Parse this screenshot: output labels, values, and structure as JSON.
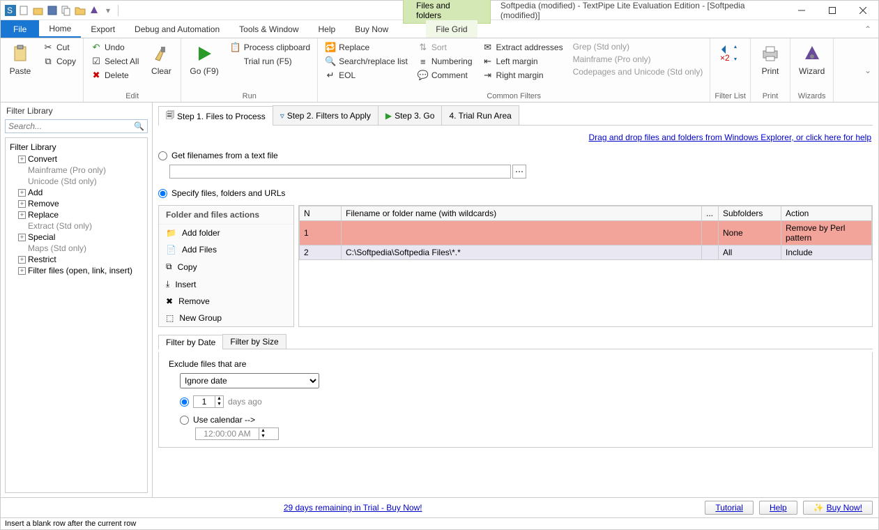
{
  "titlebar": {
    "context_tab": "Files and folders",
    "title": "Softpedia (modified) - TextPipe Lite Evaluation Edition - [Softpedia (modified)]"
  },
  "menu": {
    "file": "File",
    "home": "Home",
    "export": "Export",
    "debug": "Debug and Automation",
    "tools": "Tools & Window",
    "help": "Help",
    "buy": "Buy Now",
    "filegrid": "File Grid"
  },
  "ribbon": {
    "paste": "Paste",
    "cut": "Cut",
    "copy": "Copy",
    "edit_group": "Edit",
    "undo": "Undo",
    "select_all": "Select All",
    "delete": "Delete",
    "clear": "Clear",
    "go": "Go (F9)",
    "process_clipboard": "Process clipboard",
    "trial_run": "Trial run (F5)",
    "run_group": "Run",
    "replace": "Replace",
    "search_replace": "Search/replace list",
    "eol": "EOL",
    "sort": "Sort",
    "numbering": "Numbering",
    "comment": "Comment",
    "extract": "Extract addresses",
    "left_margin": "Left margin",
    "right_margin": "Right margin",
    "grep": "Grep (Std only)",
    "mainframe": "Mainframe (Pro only)",
    "codepages": "Codepages and Unicode (Std only)",
    "common_filters": "Common Filters",
    "filter_list": "Filter List",
    "print": "Print",
    "print_group": "Print",
    "wizard": "Wizard",
    "wizards_group": "Wizards"
  },
  "left": {
    "title": "Filter Library",
    "search_placeholder": "Search...",
    "tree_title": "Filter Library",
    "items": [
      {
        "label": "Convert",
        "expandable": true
      },
      {
        "label": "Mainframe (Pro only)",
        "child": true
      },
      {
        "label": "Unicode (Std only)",
        "child": true
      },
      {
        "label": "Add",
        "expandable": true
      },
      {
        "label": "Remove",
        "expandable": true
      },
      {
        "label": "Replace",
        "expandable": true
      },
      {
        "label": "Extract (Std only)",
        "child": true
      },
      {
        "label": "Special",
        "expandable": true
      },
      {
        "label": "Maps (Std only)",
        "child": true
      },
      {
        "label": "Restrict",
        "expandable": true
      },
      {
        "label": "Filter files (open, link, insert)",
        "expandable": true
      }
    ]
  },
  "steps": {
    "s1": "Step 1. Files to Process",
    "s2": "Step 2. Filters to Apply",
    "s3": "Step 3. Go",
    "s4": "4. Trial Run Area"
  },
  "main": {
    "drag_help": "Drag and drop files and folders from Windows Explorer, or click here for help",
    "radio_textfile": "Get filenames from a text file",
    "radio_specify": "Specify files, folders and URLs",
    "actions_title": "Folder and files actions",
    "actions": {
      "add_folder": "Add folder",
      "add_files": "Add Files",
      "copy": "Copy",
      "insert": "Insert",
      "remove": "Remove",
      "new_group": "New Group"
    },
    "grid": {
      "col_n": "N",
      "col_name": "Filename or folder name (with wildcards)",
      "col_dots": "...",
      "col_sub": "Subfolders",
      "col_action": "Action",
      "rows": [
        {
          "n": "1",
          "name": "",
          "sub": "None",
          "action": "Remove by Perl pattern"
        },
        {
          "n": "2",
          "name": "C:\\Softpedia\\Softpedia Files\\*.*",
          "sub": "All",
          "action": "Include"
        }
      ]
    }
  },
  "filter": {
    "tab_date": "Filter by Date",
    "tab_size": "Filter by Size",
    "exclude_label": "Exclude files that are",
    "select_value": "Ignore date",
    "days_value": "1",
    "days_ago": "days ago",
    "use_calendar": "Use calendar -->",
    "time_value": "12:00:00 AM"
  },
  "bottom": {
    "trial_link": "29 days remaining in Trial - Buy Now!",
    "tutorial": "Tutorial",
    "help": "Help",
    "buy": "Buy Now!",
    "hint": "Insert a blank row after the current row"
  }
}
